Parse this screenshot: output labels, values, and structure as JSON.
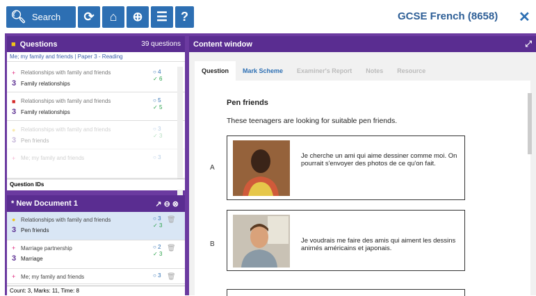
{
  "toolbar": {
    "search_label": "Search",
    "app_title": "GCSE French (8658)"
  },
  "questions": {
    "title": "Questions",
    "count": "39 questions",
    "breadcrumb": "Me; my family and friends  | Paper 3 - Reading",
    "footer": "Question IDs",
    "items": [
      {
        "marker": "+",
        "marker_color": "#e0267d",
        "topic": "Relationships with family and friends",
        "number": "3",
        "subtopic": "Family relationships",
        "open": "4",
        "done": "6"
      },
      {
        "marker": "■",
        "marker_color": "#d42a2a",
        "topic": "Relationships with family and friends",
        "number": "3",
        "subtopic": "Family relationships",
        "open": "5",
        "done": "5"
      },
      {
        "marker": "●",
        "marker_color": "#f0c419",
        "topic": "Relationships with family and friends",
        "number": "3",
        "subtopic": "Pen friends",
        "open": "3",
        "done": "3"
      },
      {
        "marker": "+",
        "marker_color": "#e0267d",
        "topic": "Me; my family and friends",
        "number": "",
        "subtopic": "",
        "open": "3",
        "done": ""
      }
    ]
  },
  "document": {
    "title": "* New Document 1",
    "footer": "Count: 3, Marks: 11, Time: 8",
    "items": [
      {
        "marker": "●",
        "marker_color": "#f0c419",
        "topic": "Relationships with family and friends",
        "number": "3",
        "subtopic": "Pen friends",
        "open": "3",
        "done": "3"
      },
      {
        "marker": "+",
        "marker_color": "#e0267d",
        "topic": "Marriage partnership",
        "number": "3",
        "subtopic": "Marriage",
        "open": "2",
        "done": "3"
      },
      {
        "marker": "+",
        "marker_color": "#e0267d",
        "topic": "Me; my family and friends",
        "number": "",
        "subtopic": "",
        "open": "3",
        "done": ""
      }
    ]
  },
  "content": {
    "title": "Content window",
    "tabs": [
      "Question",
      "Mark Scheme",
      "Examiner's Report",
      "Notes",
      "Resource"
    ],
    "active_tab": "Question",
    "paper_title": "Pen friends",
    "intro": "These teenagers are looking for suitable pen friends.",
    "entries": [
      {
        "letter": "A",
        "text": "Je cherche un ami qui aime dessiner comme moi. On pourrait s'envoyer des photos de ce qu'on fait."
      },
      {
        "letter": "B",
        "text": "Je voudrais me faire des amis qui aiment les dessins animés américains et japonais."
      }
    ]
  }
}
